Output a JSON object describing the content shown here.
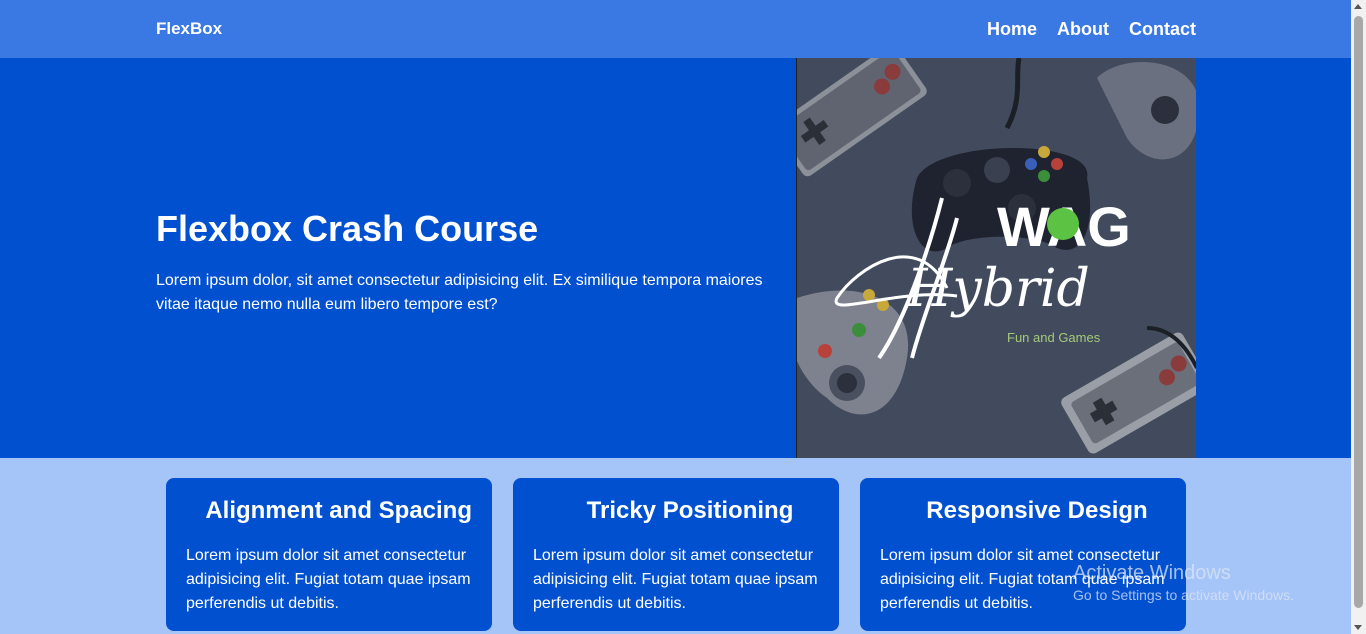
{
  "nav": {
    "logo": "FlexBox",
    "links": [
      {
        "label": "Home"
      },
      {
        "label": "About"
      },
      {
        "label": "Contact"
      }
    ]
  },
  "hero": {
    "title": "Flexbox Crash Course",
    "description": "Lorem ipsum dolor, sit amet consectetur adipisicing elit. Ex similique tempora maiores vitae itaque nemo nulla eum libero tempore est?",
    "image": {
      "logo_letters": "WAG",
      "script_text": "Hybrid",
      "tagline": "Fun and Games"
    }
  },
  "cards": [
    {
      "icon": "",
      "title": "Alignment and Spacing",
      "body": "Lorem ipsum dolor sit amet consectetur adipisicing elit. Fugiat totam quae ipsam perferendis ut debitis."
    },
    {
      "icon": "",
      "title": "Tricky Positioning",
      "body": "Lorem ipsum dolor sit amet consectetur adipisicing elit. Fugiat totam quae ipsam perferendis ut debitis."
    },
    {
      "icon": "",
      "title": "Responsive Design",
      "body": "Lorem ipsum dolor sit amet consectetur adipisicing elit. Fugiat totam quae ipsam perferendis ut debitis."
    }
  ],
  "watermark": {
    "line1": "Activate Windows",
    "line2": "Go to Settings to activate Windows."
  },
  "colors": {
    "nav_bg": "#3a78e4",
    "hero_bg": "#0050d0",
    "page_bg": "#a5c4f7",
    "card_bg": "#0050d0"
  }
}
